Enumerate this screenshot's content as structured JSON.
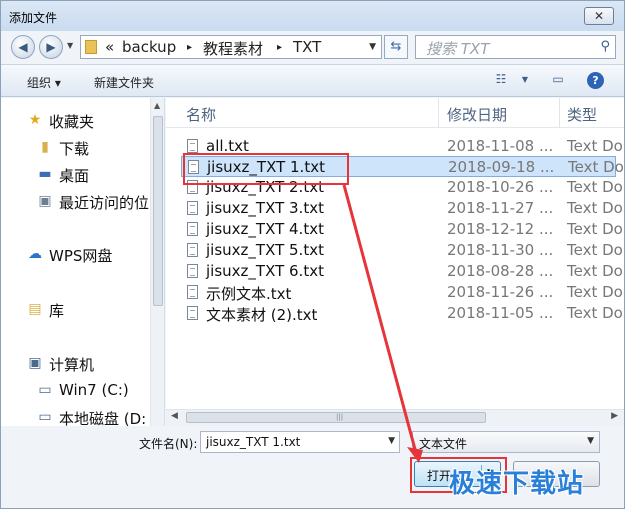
{
  "window": {
    "title": "添加文件",
    "close_glyph": "✕"
  },
  "address": {
    "prefix": "«",
    "crumbs": [
      "backup",
      "教程素材",
      "TXT"
    ],
    "separator": "▸",
    "search_placeholder": "搜索 TXT"
  },
  "toolbar": {
    "organize": "组织 ▾",
    "new_folder": "新建文件夹"
  },
  "nav_pane": {
    "items": [
      {
        "label": "收藏夹",
        "icon": "star-icon"
      },
      {
        "label": "下载",
        "icon": "download-folder-icon"
      },
      {
        "label": "桌面",
        "icon": "desktop-icon"
      },
      {
        "label": "最近访问的位",
        "icon": "recent-places-icon"
      },
      {
        "label": "WPS网盘",
        "icon": "cloud-icon"
      },
      {
        "label": "库",
        "icon": "library-icon"
      },
      {
        "label": "计算机",
        "icon": "computer-icon"
      },
      {
        "label": "Win7 (C:)",
        "icon": "drive-icon"
      },
      {
        "label": "本地磁盘 (D:",
        "icon": "drive-icon"
      }
    ]
  },
  "columns": {
    "name": "名称",
    "date": "修改日期",
    "type": "类型"
  },
  "files": [
    {
      "name": "all.txt",
      "date": "2018-11-08 ...",
      "type": "Text Do"
    },
    {
      "name": "jisuxz_TXT 1.txt",
      "date": "2018-09-18 ...",
      "type": "Text Do"
    },
    {
      "name": "jisuxz_TXT 2.txt",
      "date": "2018-10-26 ...",
      "type": "Text Do"
    },
    {
      "name": "jisuxz_TXT 3.txt",
      "date": "2018-11-27 ...",
      "type": "Text Do"
    },
    {
      "name": "jisuxz_TXT 4.txt",
      "date": "2018-12-12 ...",
      "type": "Text Do"
    },
    {
      "name": "jisuxz_TXT 5.txt",
      "date": "2018-11-30 ...",
      "type": "Text Do"
    },
    {
      "name": "jisuxz_TXT 6.txt",
      "date": "2018-08-28 ...",
      "type": "Text Do"
    },
    {
      "name": "示例文本.txt",
      "date": "2018-11-26 ...",
      "type": "Text Do"
    },
    {
      "name": "文本素材 (2).txt",
      "date": "2018-11-05 ...",
      "type": "Text Do"
    }
  ],
  "footer": {
    "filename_label": "文件名(N):",
    "filename_value": "jisuxz_TXT 1.txt",
    "filetype_value": "文本文件",
    "open_label": "打开(O)",
    "cancel_label": ""
  },
  "watermark": "极速下载站",
  "colors": {
    "selection": "#cde4fa",
    "highlight": "#e5343a",
    "watermark": "#2a7fd8"
  }
}
